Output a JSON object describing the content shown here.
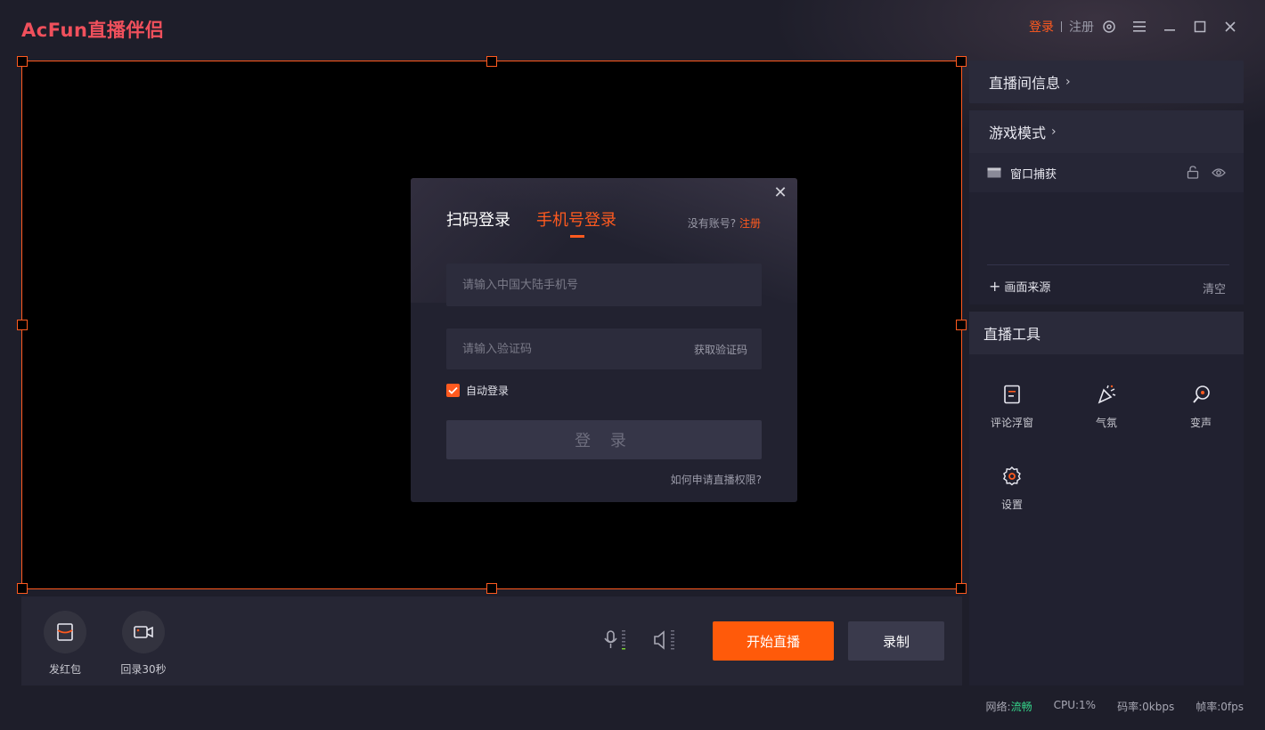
{
  "app": {
    "logo": "AcFun直播伴侣"
  },
  "titlebar": {
    "login": "登录",
    "register": "注册",
    "icons": [
      "target-icon",
      "menu-icon",
      "minimize-icon",
      "maximize-icon",
      "close-icon"
    ]
  },
  "login_dialog": {
    "tab_qr": "扫码登录",
    "tab_phone": "手机号登录",
    "active_tab": "手机号登录",
    "no_account": "没有账号?",
    "register": "注册",
    "phone_placeholder": "请输入中国大陆手机号",
    "phone_value": "",
    "code_placeholder": "请输入验证码",
    "code_value": "",
    "get_code": "获取验证码",
    "auto_login": "自动登录",
    "auto_login_checked": true,
    "login_button": "登 录",
    "apply_link": "如何申请直播权限?"
  },
  "bottombar": {
    "red_packet": "发红包",
    "replay": "回录30秒",
    "start_live": "开始直播",
    "record": "录制"
  },
  "right_panel": {
    "room_info": "直播间信息",
    "game_mode": "游戏模式",
    "source_name": "窗口捕获",
    "add_source": "画面来源",
    "clear": "清空",
    "tools_title": "直播工具",
    "tools": [
      "评论浮窗",
      "气氛",
      "变声",
      "设置"
    ]
  },
  "statusbar": {
    "network_label": "网络:",
    "network_value": "流畅",
    "cpu": "CPU:1%",
    "bitrate": "码率:0kbps",
    "fps": "帧率:0fps"
  },
  "colors": {
    "accent": "#ff5a1f",
    "logo": "#f0505c",
    "network_good": "#35d48a",
    "background": "#1e1e2a"
  }
}
